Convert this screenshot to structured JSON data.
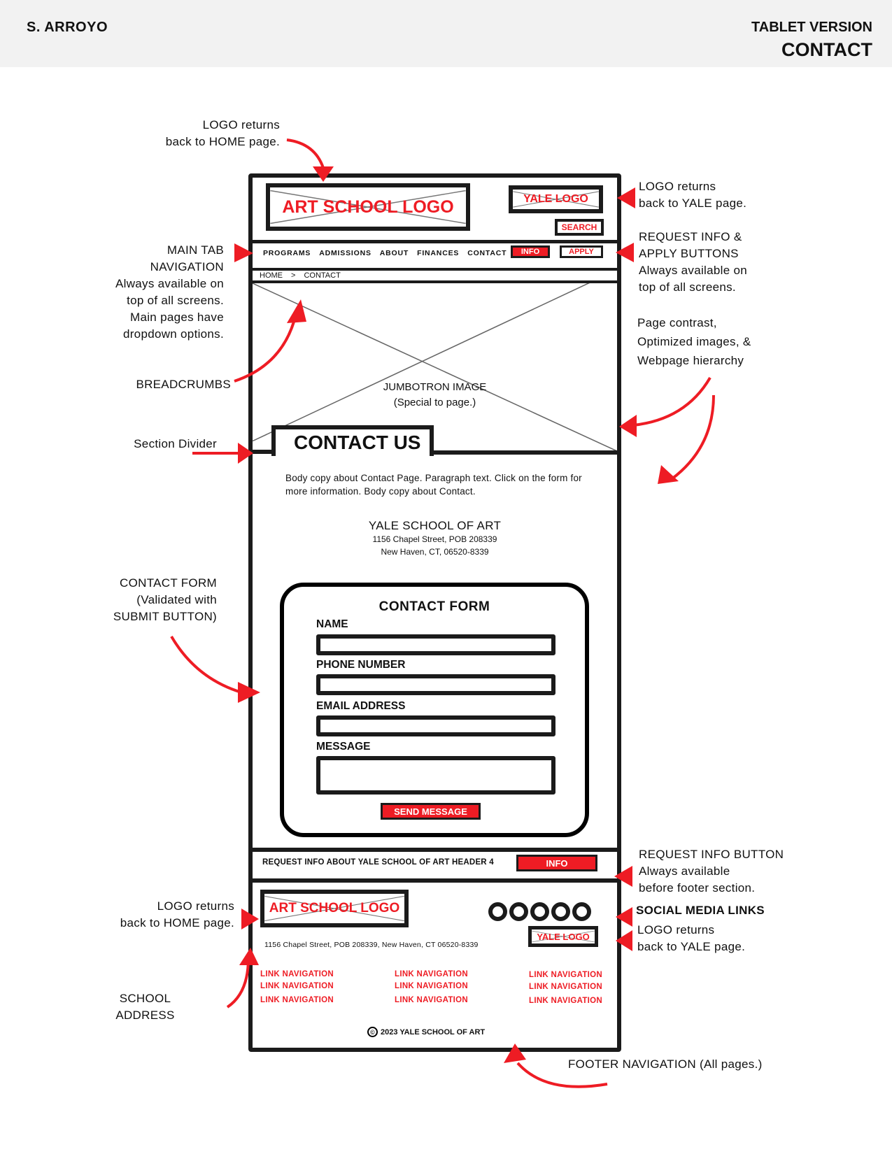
{
  "header": {
    "author": "S. ARROYO",
    "version": "TABLET VERSION",
    "page_name": "CONTACT"
  },
  "annotations": {
    "logo_home_top": [
      "LOGO returns",
      "back to HOME page."
    ],
    "logo_yale_top": [
      "LOGO returns",
      "back to YALE page."
    ],
    "main_tab_nav": [
      "MAIN TAB",
      "NAVIGATION",
      "Always available on",
      "top of all screens.",
      "Main pages have",
      "dropdown options."
    ],
    "request_apply": [
      "REQUEST INFO &",
      "APPLY BUTTONS",
      "Always available on",
      "top of all screens."
    ],
    "contrast": [
      "Page contrast,",
      "Optimized images, &",
      "Webpage hierarchy"
    ],
    "breadcrumbs": "BREADCRUMBS",
    "section_divider": "Section Divider",
    "contact_form": [
      "CONTACT FORM",
      "(Validated with",
      "SUBMIT BUTTON)"
    ],
    "request_info_button": [
      "REQUEST INFO BUTTON",
      "Always available",
      "before footer section."
    ],
    "social_media": "SOCIAL MEDIA LINKS",
    "logo_home_footer": [
      "LOGO returns",
      "back to HOME page."
    ],
    "logo_yale_footer": [
      "LOGO returns",
      "back to YALE page."
    ],
    "school_address": [
      "SCHOOL",
      "ADDRESS"
    ],
    "footer_nav": "FOOTER NAVIGATION (All pages.)"
  },
  "wireframe": {
    "art_school_logo": "ART SCHOOL LOGO",
    "yale_logo": "YALE LOGO",
    "search": "SEARCH",
    "nav": [
      "PROGRAMS",
      "ADMISSIONS",
      "ABOUT",
      "FINANCES",
      "CONTACT"
    ],
    "info": "INFO",
    "apply": "APPLY",
    "breadcrumb": [
      "HOME",
      ">",
      "CONTACT"
    ],
    "jumbotron": [
      "JUMBOTRON IMAGE",
      "(Special to page.)"
    ],
    "section_title": "CONTACT US",
    "body_copy": "Body copy about Contact Page. Paragraph text. Click on the form for more information. Body copy about Contact.",
    "school_name": "YALE SCHOOL OF ART",
    "school_address": [
      "1156 Chapel Street, POB 208339",
      "New Haven, CT, 06520-8339"
    ],
    "form": {
      "title": "CONTACT FORM",
      "fields": [
        "NAME",
        "PHONE NUMBER",
        "EMAIL ADDRESS",
        "MESSAGE"
      ],
      "submit": "SEND MESSAGE"
    },
    "request_bar": {
      "text": "REQUEST INFO ABOUT YALE SCHOOL OF ART HEADER 4",
      "button": "INFO"
    },
    "footer": {
      "logo": "ART SCHOOL LOGO",
      "yale_logo": "YALE LOGO",
      "address": "1156 Chapel Street, POB 208339, New Haven, CT 06520-8339",
      "link_columns": [
        [
          "LINK NAVIGATION",
          "LINK NAVIGATION",
          "LINK NAVIGATION"
        ],
        [
          "LINK NAVIGATION",
          "LINK NAVIGATION",
          "LINK NAVIGATION"
        ],
        [
          "LINK NAVIGATION",
          "LINK NAVIGATION",
          "LINK NAVIGATION"
        ]
      ],
      "social_icons": [
        "social-1",
        "social-2",
        "social-3",
        "social-4",
        "social-5"
      ],
      "copyright_symbol": "©",
      "copyright": "2023 YALE SCHOOL OF ART"
    }
  },
  "colors": {
    "accent_red": "#ee1c24",
    "ink": "#1b1b1b",
    "header_bg": "#f2f2f2"
  }
}
